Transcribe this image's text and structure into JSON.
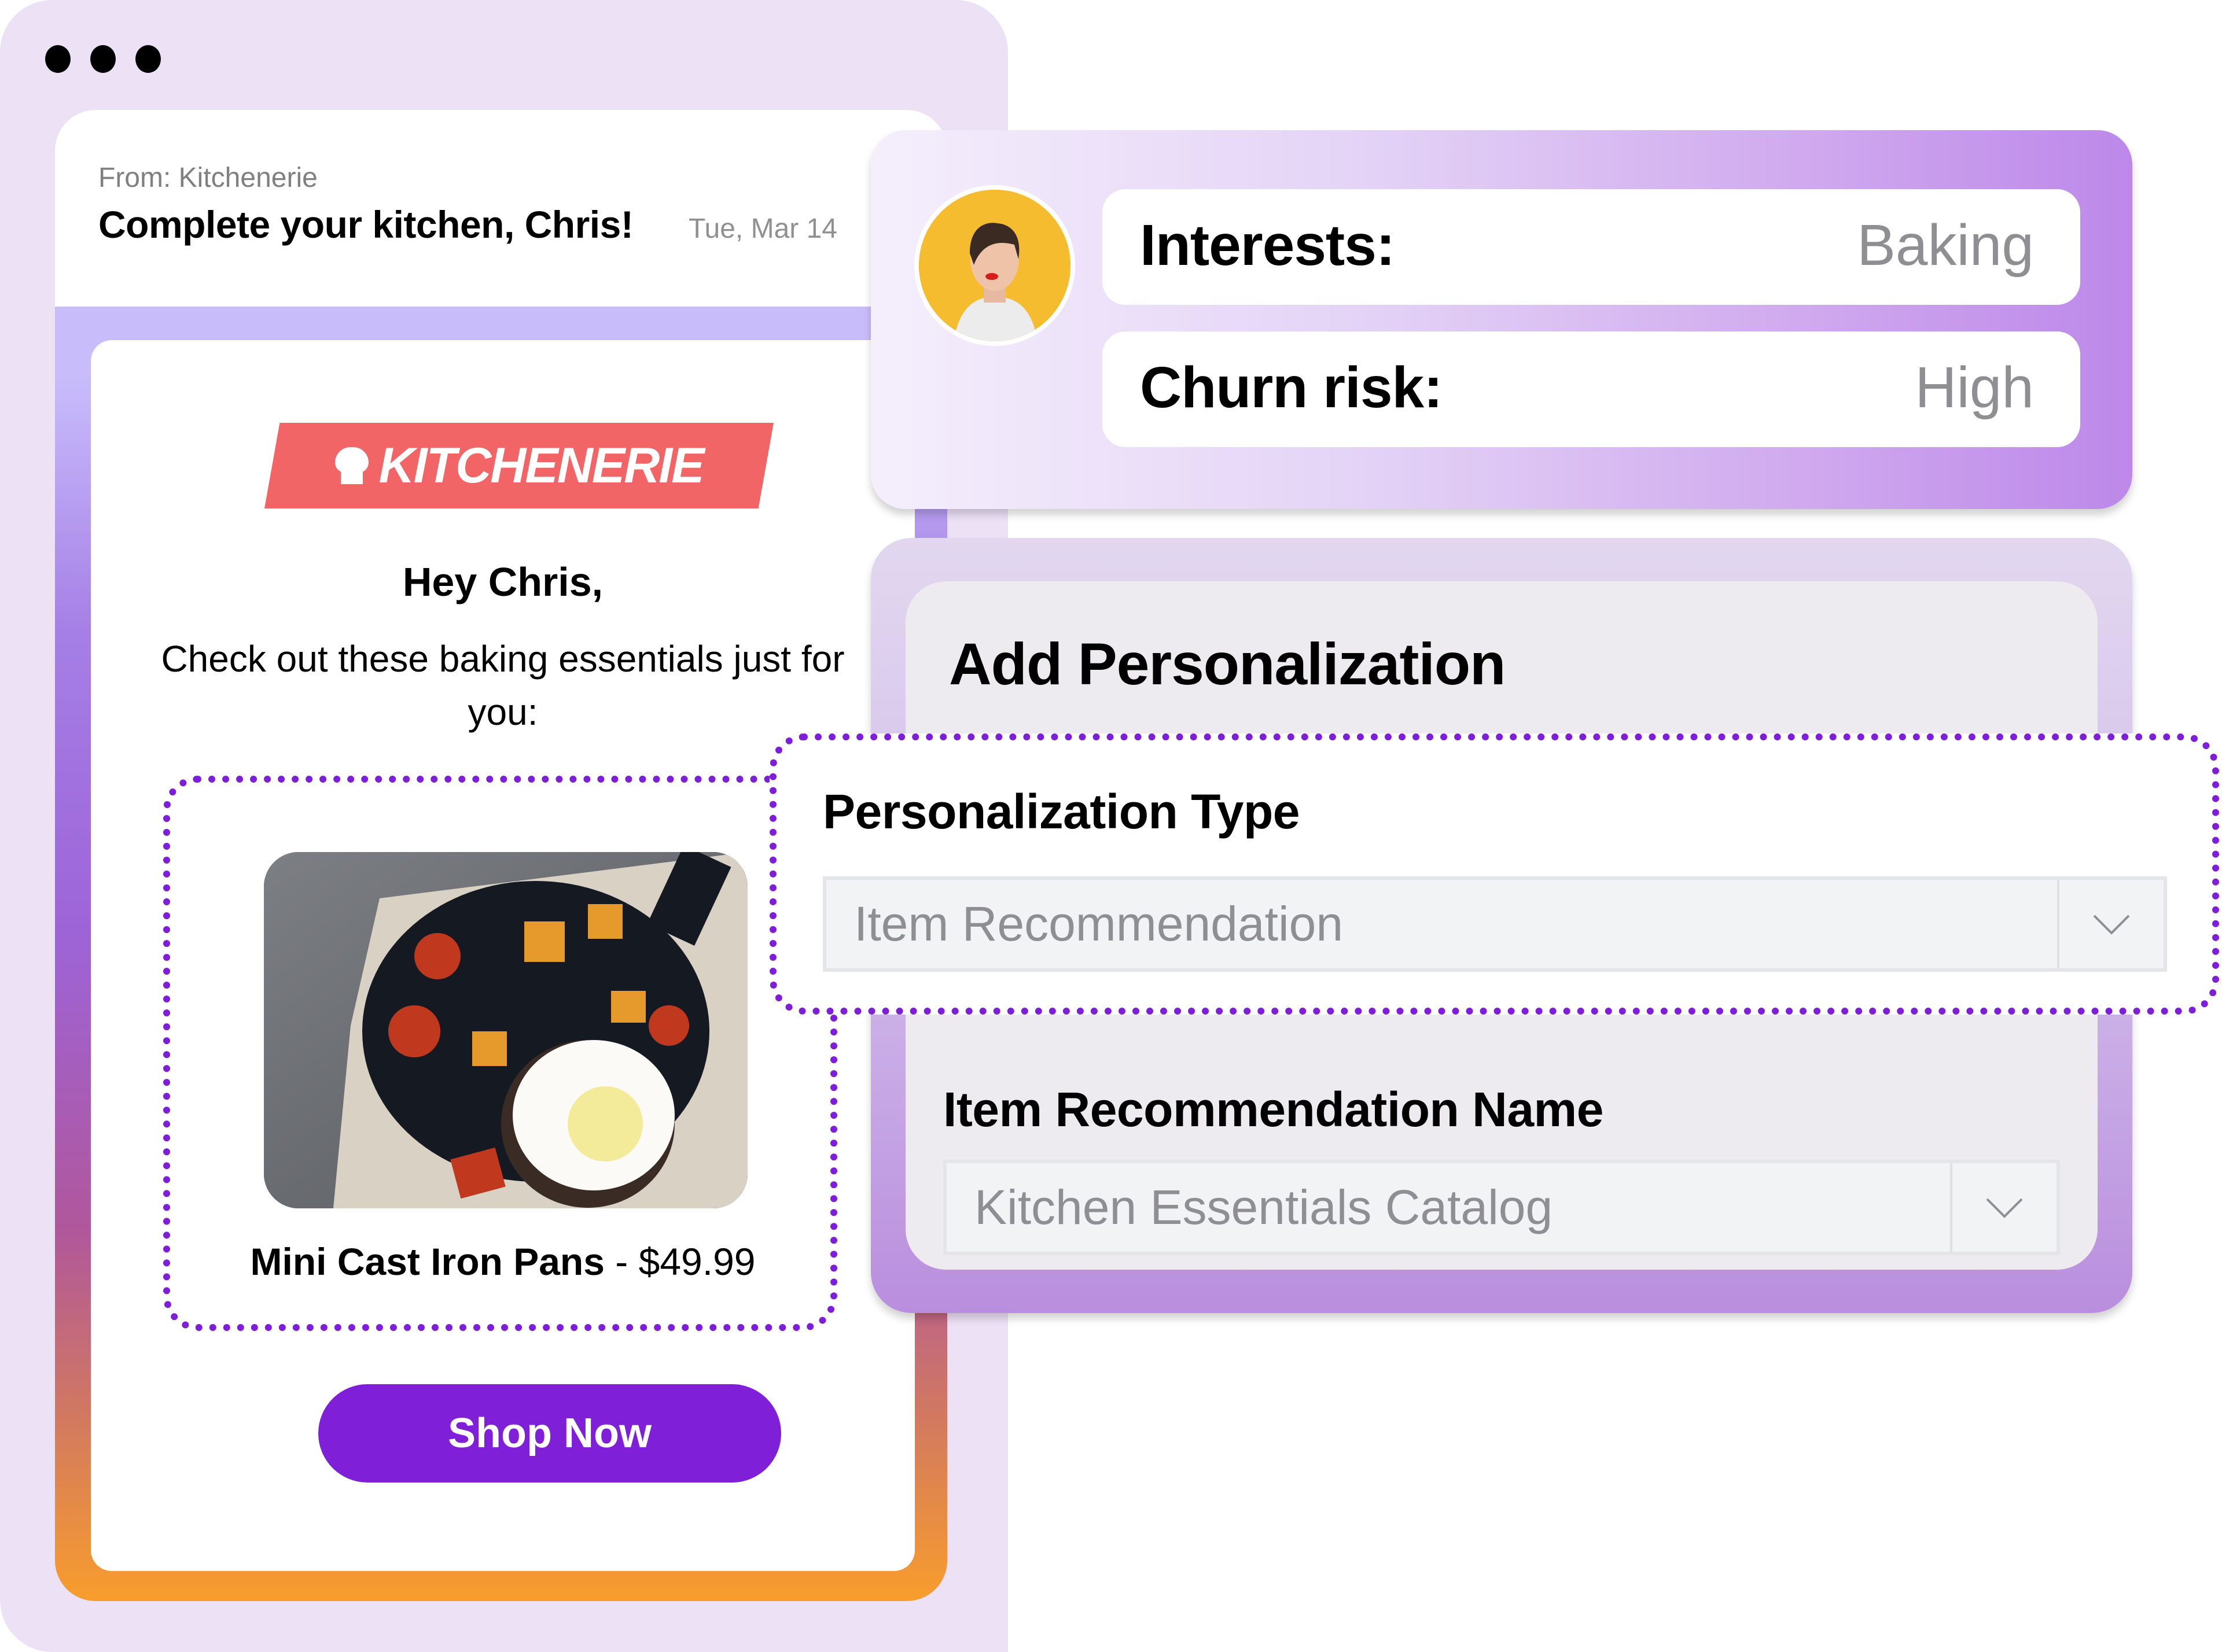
{
  "window": {
    "dots": [
      "window-dot-1",
      "window-dot-2",
      "window-dot-3"
    ]
  },
  "email": {
    "from": "From: Kitchenerie",
    "subject": "Complete your kitchen, Chris!",
    "date": "Tue, Mar 14",
    "logo_text": "KITCHENERIE",
    "logo_icon": "chef-hat-icon",
    "greeting": "Hey Chris,",
    "intro": "Check out these baking essentials just for you:",
    "product": {
      "name": "Mini Cast Iron Pans",
      "separator": " - ",
      "price": "$49.99",
      "image_alt": "Cast iron pan with fried egg and roasted vegetables"
    },
    "cta_label": "Shop Now"
  },
  "profile": {
    "avatar_alt": "Customer avatar",
    "attributes": [
      {
        "label": "Interests:",
        "value": "Baking"
      },
      {
        "label": "Churn risk:",
        "value": "High"
      }
    ]
  },
  "personalization": {
    "title": "Add Personalization",
    "type_label": "Personalization Type",
    "type_value": "Item Recommendation",
    "name_label": "Item Recommendation Name",
    "name_value": "Kitchen Essentials Catalog"
  },
  "colors": {
    "accent_purple": "#7f1fd8",
    "logo_red": "#f26566",
    "window_bg": "#ede1f6",
    "muted_text": "#8e8e93"
  }
}
